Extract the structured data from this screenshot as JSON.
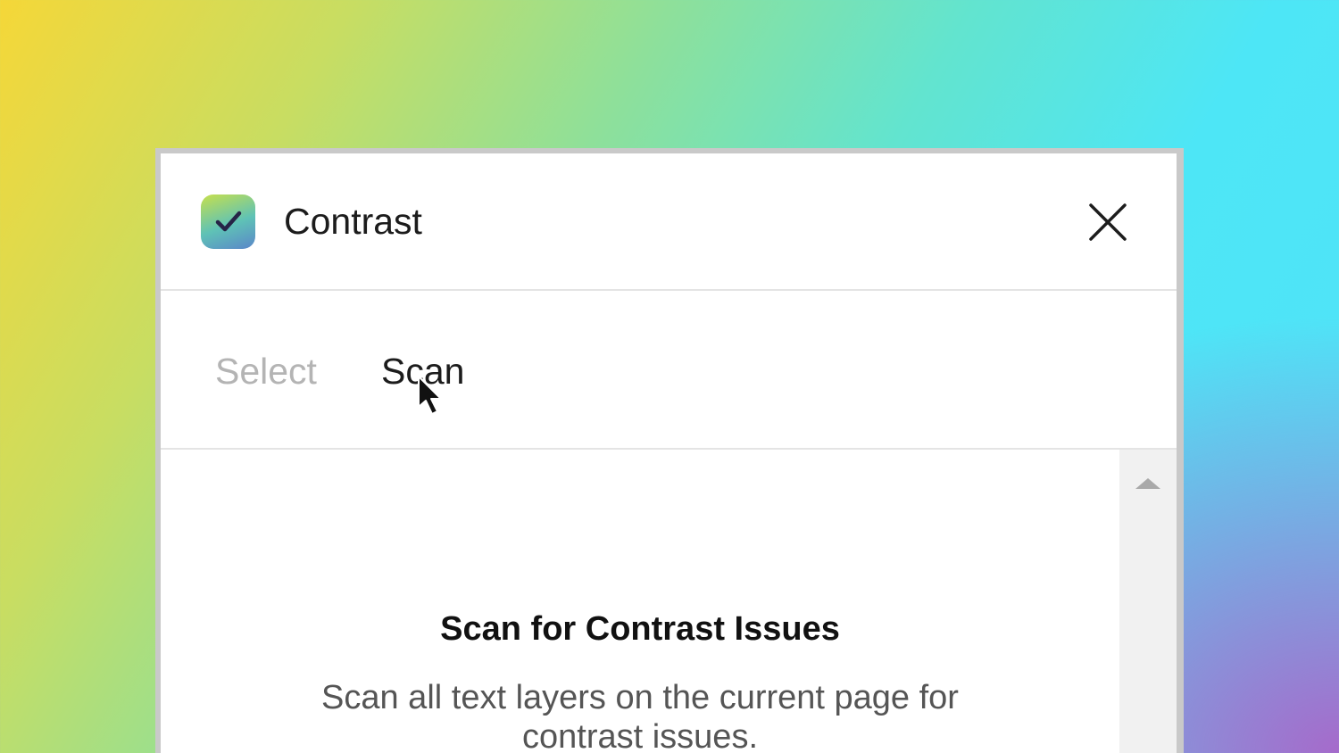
{
  "app": {
    "title": "Contrast",
    "icon": "checkmark-icon",
    "icon_colors": [
      "#c7e04c",
      "#5fc2b6",
      "#5a86c9"
    ]
  },
  "header": {
    "close_icon": "close-icon"
  },
  "tabs": [
    {
      "label": "Select",
      "active": false
    },
    {
      "label": "Scan",
      "active": true
    }
  ],
  "content": {
    "title": "Scan for Contrast Issues",
    "description": "Scan all text layers on the current page for contrast issues."
  },
  "scrollbar": {
    "up_icon": "triangle-up-icon"
  },
  "colors": {
    "active_tab": "#1c1c1c",
    "inactive_tab": "#b4b4b4"
  }
}
